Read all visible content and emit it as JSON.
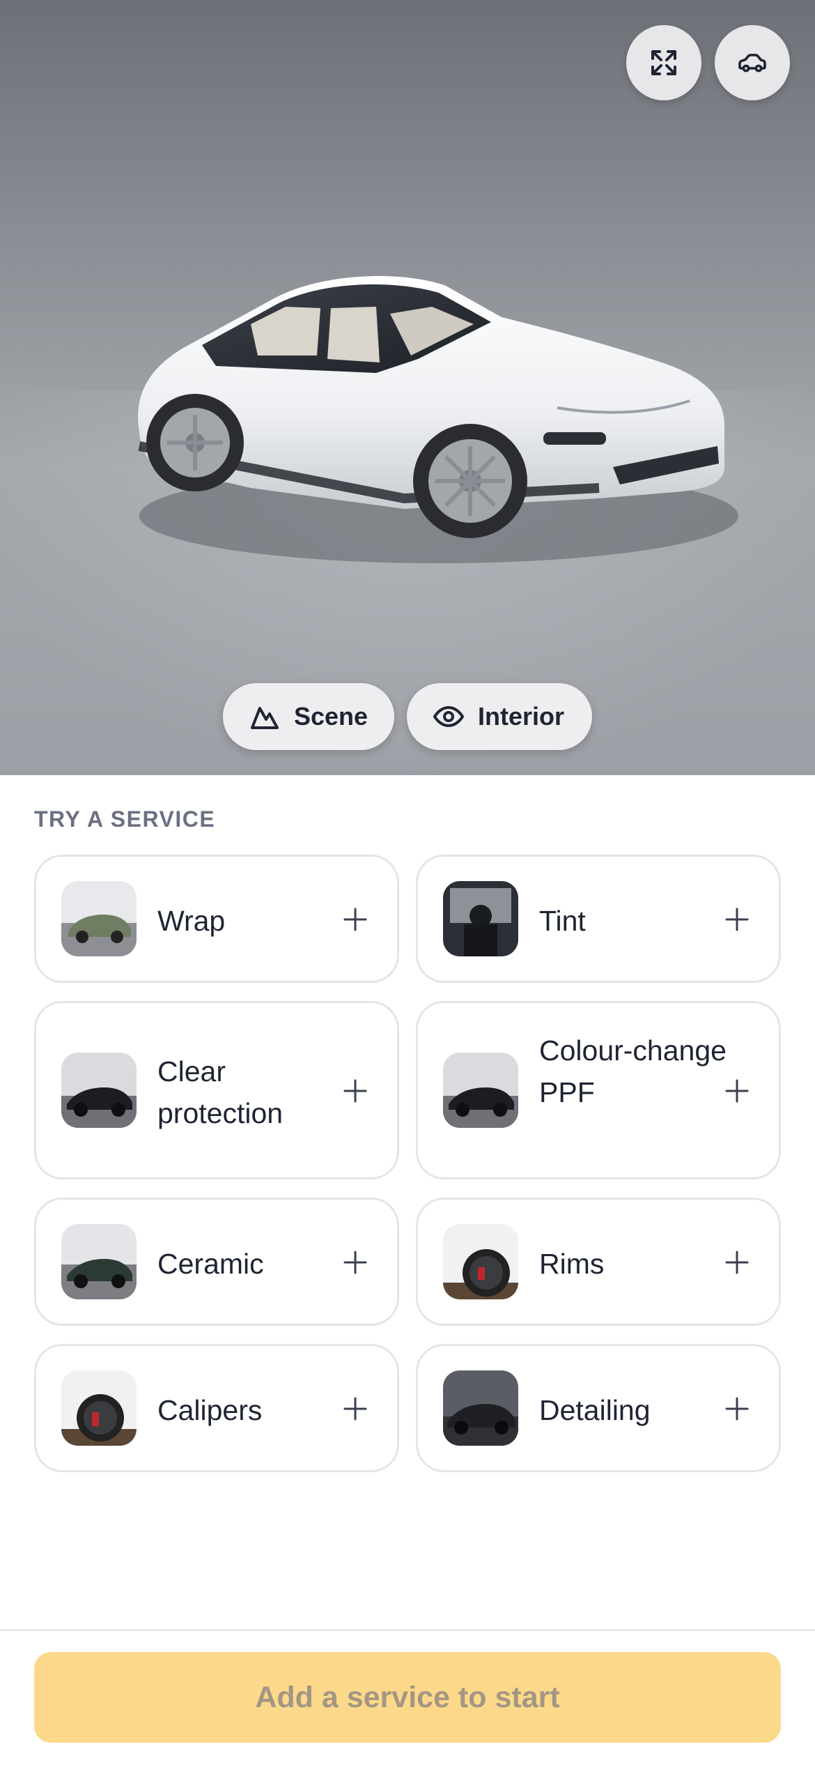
{
  "viewer": {
    "expand_icon": "expand-arrows-icon",
    "car_icon": "car-icon",
    "scene_label": "Scene",
    "interior_label": "Interior",
    "model_color": "#f4f5f7"
  },
  "services": {
    "title": "TRY A SERVICE",
    "items": [
      {
        "label": "Wrap",
        "thumb_color": "#6f7d62",
        "action_icon": "plus-icon"
      },
      {
        "label": "Tint",
        "thumb_color": "#2b2f36",
        "action_icon": "plus-icon"
      },
      {
        "label": "Clear protection",
        "thumb_color": "#1b1d22",
        "action_icon": "plus-icon"
      },
      {
        "label": "Colour-change PPF",
        "thumb_color": "#1b1d22",
        "action_icon": "plus-icon"
      },
      {
        "label": "Ceramic",
        "thumb_color": "#2c3a34",
        "action_icon": "plus-icon"
      },
      {
        "label": "Rims",
        "thumb_color": "#f1f1f3",
        "action_icon": "plus-icon"
      },
      {
        "label": "Calipers",
        "thumb_color": "#f1f1f3",
        "action_icon": "plus-icon"
      },
      {
        "label": "Detailing",
        "thumb_color": "#1e2026",
        "action_icon": "plus-icon"
      }
    ]
  },
  "footer": {
    "cta_label": "Add a service to start",
    "cta_color": "#fcd98a"
  }
}
